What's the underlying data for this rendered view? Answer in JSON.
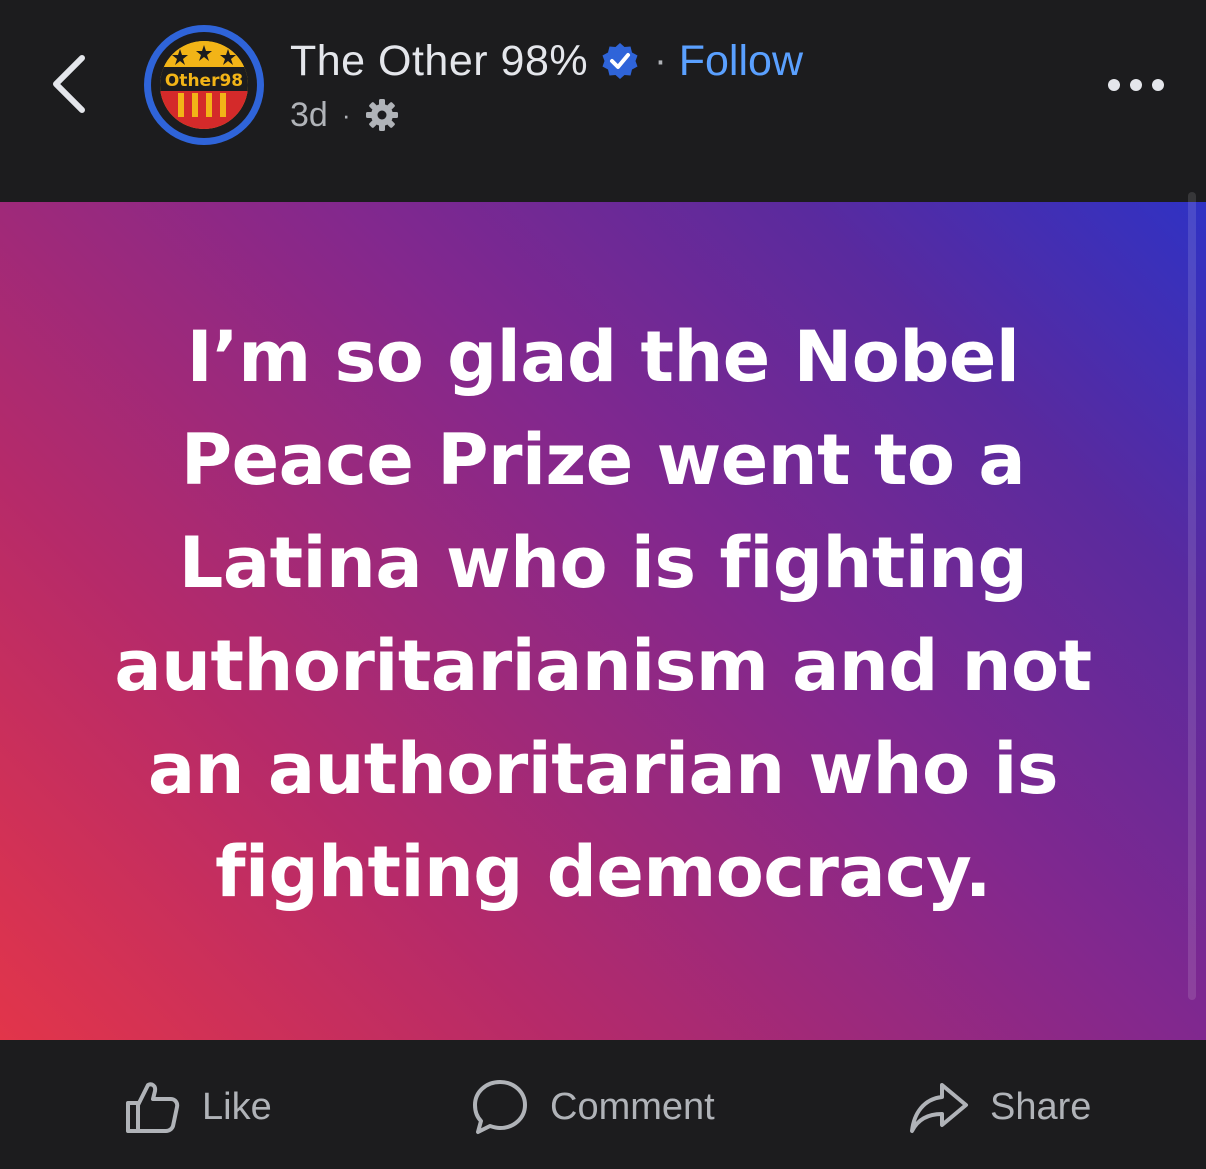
{
  "header": {
    "page_name": "The Other 98%",
    "separator": "·",
    "follow_label": "Follow",
    "post_age": "3d",
    "meta_separator": "·",
    "avatar_text": "Other98",
    "icons": {
      "back": "chevron-left-icon",
      "verified": "verified-badge-icon",
      "audience": "gear-icon",
      "more": "more-horizontal-icon"
    },
    "colors": {
      "follow": "#5aa0ff",
      "verified": "#2f64d9",
      "avatar_ring": "#2f64d9"
    }
  },
  "post": {
    "text": "I’m so glad the Nobel Peace Prize went to a Latina who is fighting authoritarianism and not an authoritarian who is fighting democracy.",
    "background_colors": [
      "#e2354a",
      "#82288e",
      "#2f32c4"
    ]
  },
  "actions": {
    "like_label": "Like",
    "comment_label": "Comment",
    "share_label": "Share",
    "icons": {
      "like": "thumbs-up-icon",
      "comment": "comment-bubble-icon",
      "share": "share-arrow-icon"
    }
  }
}
